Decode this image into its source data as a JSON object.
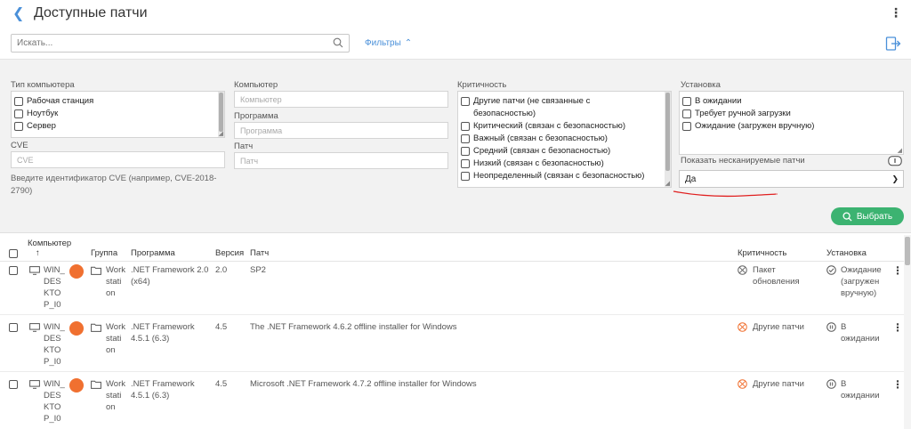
{
  "header": {
    "title": "Доступные патчи"
  },
  "search": {
    "placeholder": "Искать..."
  },
  "filters_toggle": "Фильтры",
  "filters": {
    "computer_type": {
      "label": "Тип компьютера",
      "options": [
        "Рабочая станция",
        "Ноутбук",
        "Сервер"
      ]
    },
    "cve": {
      "label": "CVE",
      "placeholder": "CVE",
      "hint": "Введите идентификатор CVE (например, CVE-2018-2790)"
    },
    "computer": {
      "label": "Компьютер",
      "placeholder": "Компьютер"
    },
    "program": {
      "label": "Программа",
      "placeholder": "Программа"
    },
    "patch": {
      "label": "Патч",
      "placeholder": "Патч"
    },
    "criticality": {
      "label": "Критичность",
      "options": [
        "Другие патчи (не связанные с безопасностью)",
        "Критический (связан с безопасностью)",
        "Важный (связан с безопасностью)",
        "Средний (связан с безопасностью)",
        "Низкий (связан с безопасностью)",
        "Неопределенный (связан с безопасностью)"
      ]
    },
    "install": {
      "label": "Установка",
      "options": [
        "В ожидании",
        "Требует ручной загрузки",
        "Ожидание (загружен вручную)"
      ]
    },
    "show_unscannable": {
      "label": "Показать несканируемые патчи",
      "value": "Да"
    }
  },
  "select_button": "Выбрать",
  "table": {
    "columns": {
      "computer": "Компьютер",
      "sort_arrow": "↑",
      "group": "Группа",
      "program": "Программа",
      "version": "Версия",
      "patch": "Патч",
      "criticality": "Критичность",
      "install": "Установка"
    },
    "rows": [
      {
        "computer": "WIN_DESKTOP_I0",
        "group": "Workstation",
        "program": ".NET Framework 2.0 (x64)",
        "version": "2.0",
        "patch": "SP2",
        "criticality": "Пакет обновления",
        "install": "Ожидание (загружен вручную)"
      },
      {
        "computer": "WIN_DESKTOP_I0",
        "group": "Workstation",
        "program": ".NET Framework 4.5.1 (6.3)",
        "version": "4.5",
        "patch": "The .NET Framework 4.6.2 offline installer for Windows",
        "criticality": "Другие патчи",
        "install": "В ожидании"
      },
      {
        "computer": "WIN_DESKTOP_I0",
        "group": "Workstation",
        "program": ".NET Framework 4.5.1 (6.3)",
        "version": "4.5",
        "patch": "Microsoft .NET Framework 4.7.2 offline installer for Windows",
        "criticality": "Другие патчи",
        "install": "В ожидании"
      }
    ]
  },
  "colors": {
    "accent": "#4a90d9",
    "green": "#3cb371",
    "orange": "#f07030",
    "red_underline": "#e02020"
  }
}
